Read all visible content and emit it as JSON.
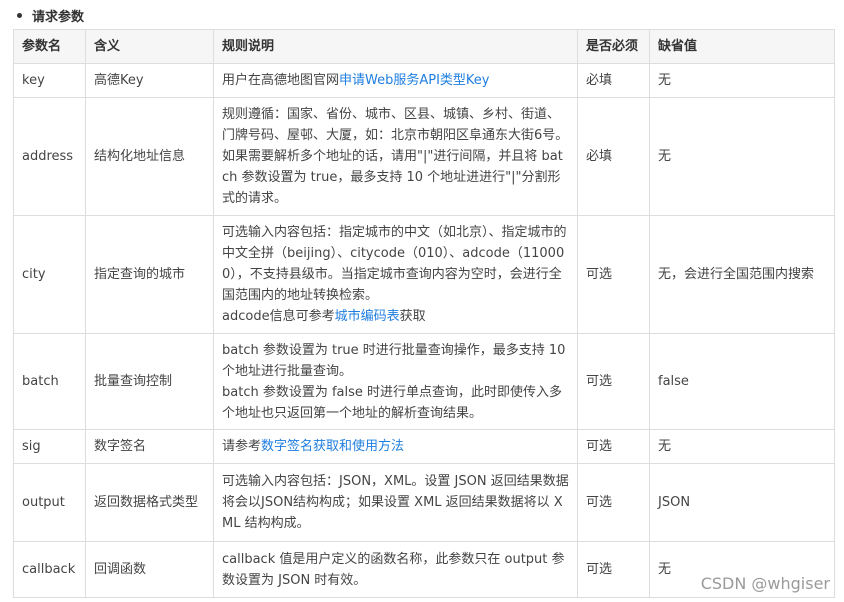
{
  "section_title": "请求参数",
  "table": {
    "headers": [
      "参数名",
      "含义",
      "规则说明",
      "是否必须",
      "缺省值"
    ],
    "rows": [
      {
        "name": "key",
        "meaning": "高德Key",
        "desc": [
          {
            "t": "用户在高德地图官网"
          },
          {
            "t": "申请Web服务API类型Key",
            "link": true
          }
        ],
        "required": "必填",
        "default": "无"
      },
      {
        "name": "address",
        "meaning": "结构化地址信息",
        "desc": [
          {
            "t": "规则遵循：国家、省份、城市、区县、城镇、乡村、街道、门牌号码、屋邨、大厦，如：北京市朝阳区阜通东大街6号。如果需要解析多个地址的话，请用\"|\"进行间隔，并且将 batch 参数设置为 true，最多支持 10 个地址进进行\"|\"分割形式的请求。"
          }
        ],
        "required": "必填",
        "default": "无"
      },
      {
        "name": "city",
        "meaning": "指定查询的城市",
        "desc": [
          {
            "t": "可选输入内容包括：指定城市的中文（如北京）、指定城市的中文全拼（beijing）、citycode（010）、adcode（110000），不支持县级市。当指定城市查询内容为空时，会进行全国范围内的地址转换检索。"
          },
          {
            "br": true
          },
          {
            "t": "adcode信息可参考"
          },
          {
            "t": "城市编码表",
            "link": true
          },
          {
            "t": "获取"
          }
        ],
        "required": "可选",
        "default": "无，会进行全国范围内搜索"
      },
      {
        "name": "batch",
        "meaning": "批量查询控制",
        "desc": [
          {
            "t": "batch 参数设置为 true 时进行批量查询操作，最多支持 10 个地址进行批量查询。"
          },
          {
            "br": true
          },
          {
            "t": "batch 参数设置为 false 时进行单点查询，此时即使传入多个地址也只返回第一个地址的解析查询结果。"
          }
        ],
        "required": "可选",
        "default": "false"
      },
      {
        "name": "sig",
        "meaning": "数字签名",
        "desc": [
          {
            "t": "请参考"
          },
          {
            "t": "数字签名获取和使用方法",
            "link": true
          }
        ],
        "required": "可选",
        "default": "无"
      },
      {
        "name": "output",
        "meaning": "返回数据格式类型",
        "desc": [
          {
            "t": "可选输入内容包括：JSON，XML。设置 JSON 返回结果数据将会以JSON结构构成；如果设置 XML 返回结果数据将以 XML 结构构成。"
          }
        ],
        "required": "可选",
        "default": "JSON"
      },
      {
        "name": "callback",
        "meaning": "回调函数",
        "desc": [
          {
            "t": "callback 值是用户定义的函数名称，此参数只在 output 参数设置为 JSON 时有效。"
          }
        ],
        "required": "可选",
        "default": "无"
      }
    ]
  },
  "watermark": "CSDN @whgiser",
  "colors": {
    "link": "#1f7ee0",
    "header_bg": "#f6f6f6",
    "border": "#dddddd"
  }
}
